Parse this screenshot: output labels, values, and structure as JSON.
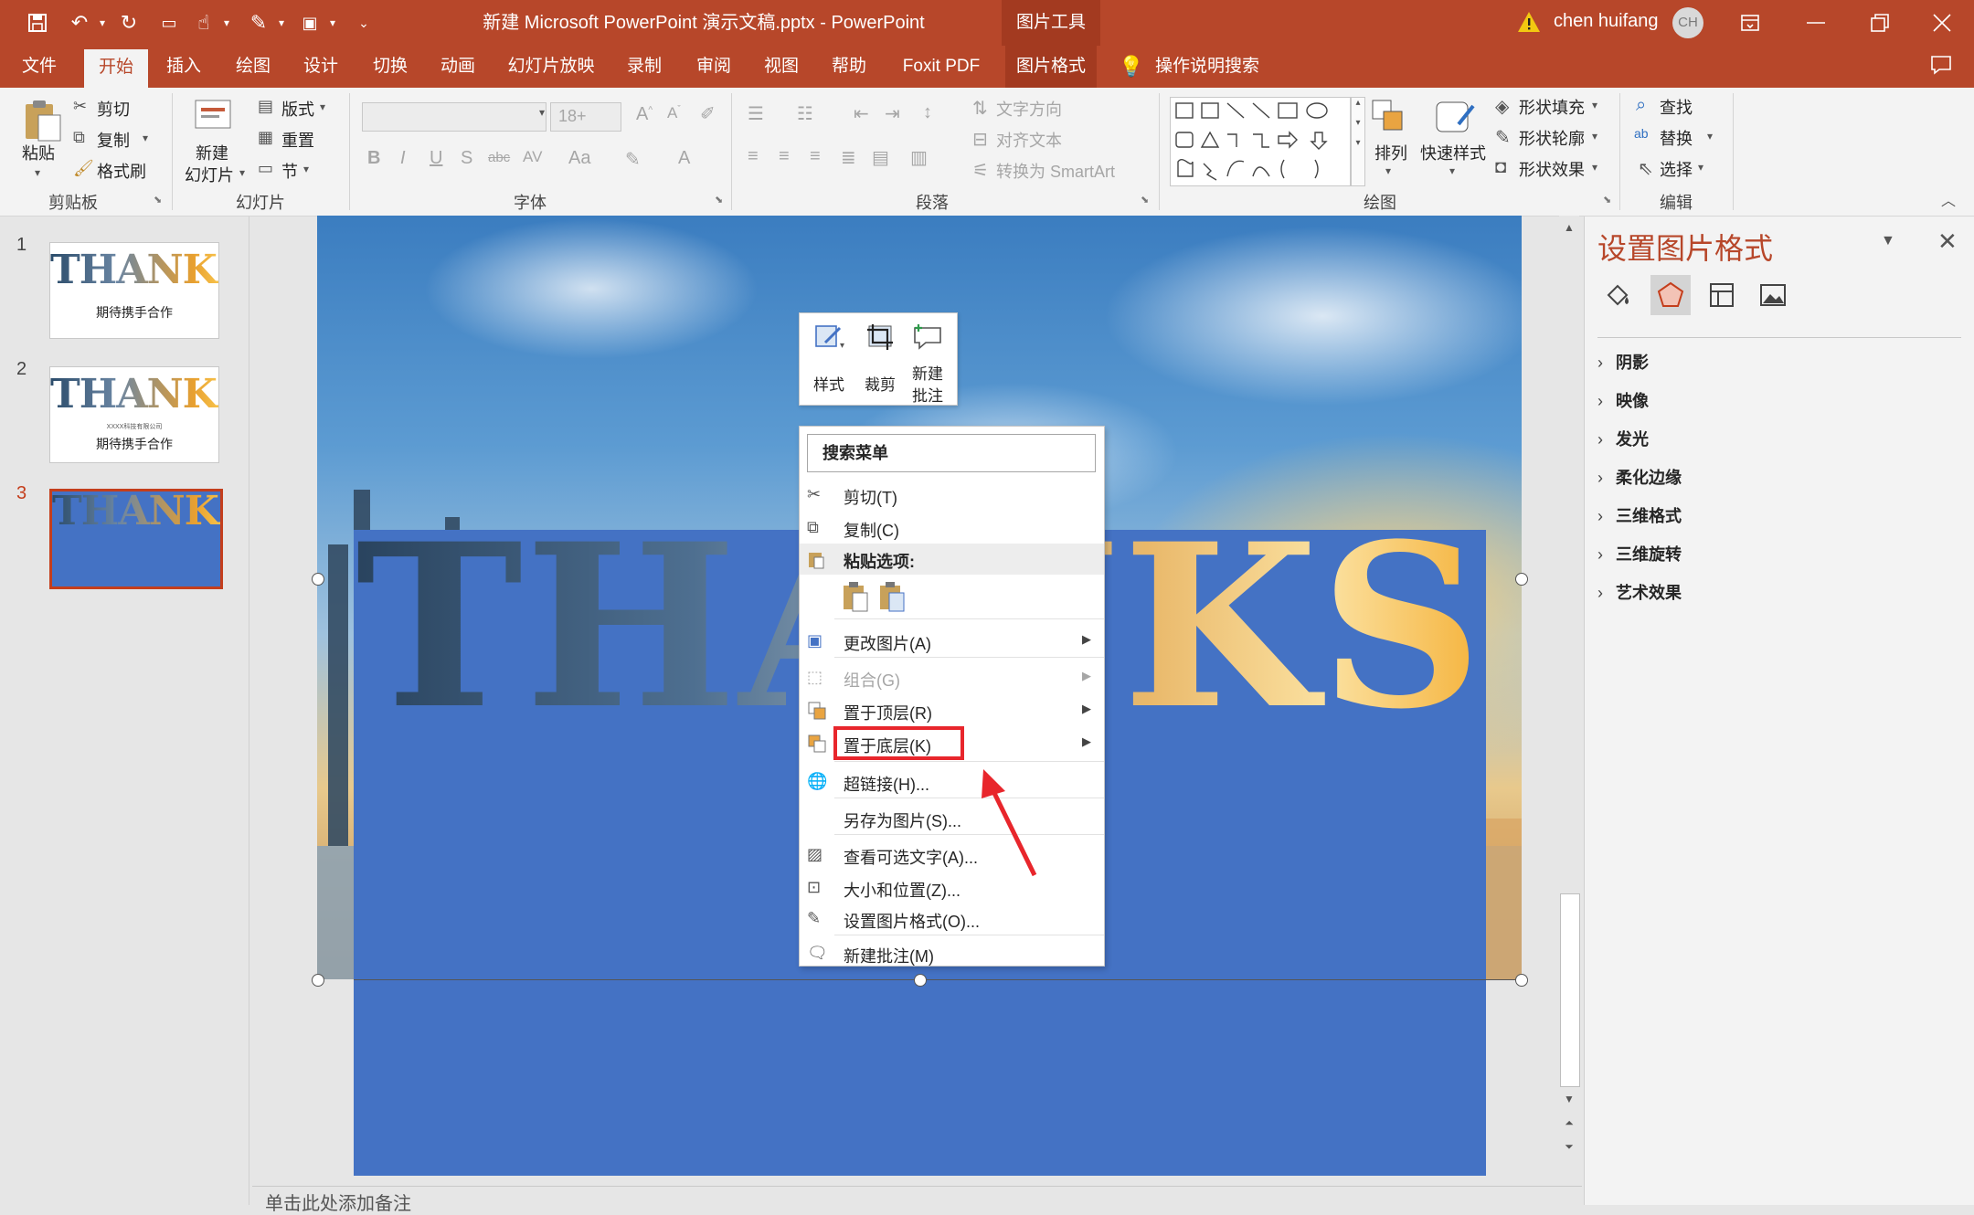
{
  "titlebar": {
    "title": "新建 Microsoft PowerPoint 演示文稿.pptx  -  PowerPoint",
    "context_tools": "图片工具",
    "user_name": "chen huifang",
    "avatar_initials": "CH"
  },
  "tabs": [
    {
      "label": "文件"
    },
    {
      "label": "开始"
    },
    {
      "label": "插入"
    },
    {
      "label": "绘图"
    },
    {
      "label": "设计"
    },
    {
      "label": "切换"
    },
    {
      "label": "动画"
    },
    {
      "label": "幻灯片放映"
    },
    {
      "label": "录制"
    },
    {
      "label": "审阅"
    },
    {
      "label": "视图"
    },
    {
      "label": "帮助"
    },
    {
      "label": "Foxit PDF"
    },
    {
      "label": "图片格式"
    }
  ],
  "tell_me": "操作说明搜索",
  "ribbon": {
    "clipboard": {
      "paste": "粘贴",
      "cut": "剪切",
      "copy": "复制",
      "format_painter": "格式刷",
      "label": "剪贴板"
    },
    "slides": {
      "new_slide": "新建",
      "new_slide2": "幻灯片",
      "layout": "版式",
      "reset": "重置",
      "section": "节",
      "label": "幻灯片"
    },
    "font": {
      "size": "18+",
      "label": "字体"
    },
    "paragraph": {
      "text_direction": "文字方向",
      "align_text": "对齐文本",
      "smartart": "转换为 SmartArt",
      "label": "段落"
    },
    "drawing": {
      "arrange": "排列",
      "quick_styles": "快速样式",
      "shape_fill": "形状填充",
      "shape_outline": "形状轮廓",
      "shape_effects": "形状效果",
      "label": "绘图"
    },
    "editing": {
      "find": "查找",
      "replace": "替换",
      "select": "选择",
      "label": "编辑"
    }
  },
  "slides": [
    {
      "num": "1",
      "word": "THANKS",
      "subtitle": "期待携手合作"
    },
    {
      "num": "2",
      "word": "THANKS",
      "tiny": "XXXX科技有限公司",
      "subtitle": "期待携手合作"
    },
    {
      "num": "3",
      "word": "THANKS"
    }
  ],
  "slide": {
    "word": "THANKS"
  },
  "notes_placeholder": "单击此处添加备注",
  "task_pane": {
    "title": "设置图片格式",
    "sections": [
      "阴影",
      "映像",
      "发光",
      "柔化边缘",
      "三维格式",
      "三维旋转",
      "艺术效果"
    ]
  },
  "mini_toolbar": {
    "style": "样式",
    "crop": "裁剪",
    "new_comment_1": "新建",
    "new_comment_2": "批注"
  },
  "context_menu": {
    "search": "搜索菜单",
    "items": [
      {
        "label": "剪切(T)"
      },
      {
        "label": "复制(C)"
      },
      {
        "label": "粘贴选项:"
      },
      {
        "label": "更改图片(A)"
      },
      {
        "label": "组合(G)"
      },
      {
        "label": "置于顶层(R)"
      },
      {
        "label": "置于底层(K)"
      },
      {
        "label": "超链接(H)..."
      },
      {
        "label": "另存为图片(S)..."
      },
      {
        "label": "查看可选文字(A)..."
      },
      {
        "label": "大小和位置(Z)..."
      },
      {
        "label": "设置图片格式(O)..."
      },
      {
        "label": "新建批注(M)"
      }
    ],
    "highlighted_item": "置于底层(K)"
  },
  "colors": {
    "accent": "#b7472a",
    "slide_blue": "#4472c4",
    "annotation": "#e8262c"
  }
}
